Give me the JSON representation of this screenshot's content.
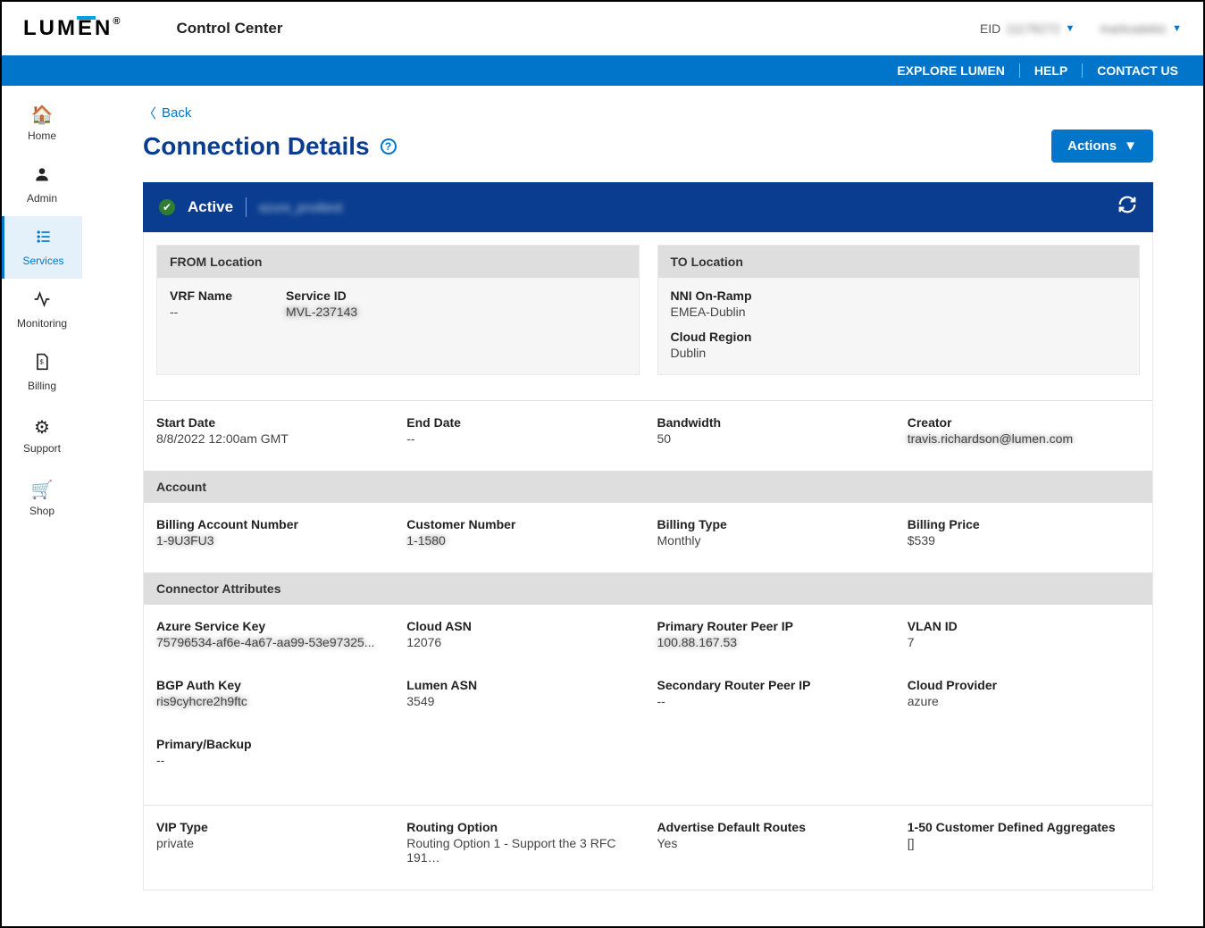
{
  "header": {
    "logo_text": "LUM",
    "logo_text2": "E",
    "logo_text3": "N",
    "app_title": "Control Center",
    "eid_label": "EID",
    "eid_value": "11176272",
    "username": "markoalekic"
  },
  "bluebar": {
    "explore": "EXPLORE LUMEN",
    "help": "HELP",
    "contact": "CONTACT US"
  },
  "sidebar": {
    "items": [
      {
        "label": "Home"
      },
      {
        "label": "Admin"
      },
      {
        "label": "Services"
      },
      {
        "label": "Monitoring"
      },
      {
        "label": "Billing"
      },
      {
        "label": "Support"
      },
      {
        "label": "Shop"
      }
    ]
  },
  "back_label": "Back",
  "page_title": "Connection Details",
  "actions_label": "Actions",
  "status": {
    "state": "Active",
    "name": "azure_prodtest"
  },
  "from": {
    "heading": "FROM Location",
    "vrf_label": "VRF Name",
    "vrf_value": "--",
    "service_id_label": "Service ID",
    "service_id_value": "MVL-237143"
  },
  "to": {
    "heading": "TO Location",
    "nni_label": "NNI On-Ramp",
    "nni_value": "EMEA-Dublin",
    "region_label": "Cloud Region",
    "region_value": "Dublin"
  },
  "dates": {
    "start_label": "Start Date",
    "start_value": "8/8/2022 12:00am GMT",
    "end_label": "End Date",
    "end_value": "--",
    "bandwidth_label": "Bandwidth",
    "bandwidth_value": "50",
    "creator_label": "Creator",
    "creator_value": "travis.richardson@lumen.com"
  },
  "account": {
    "heading": "Account",
    "ban_label": "Billing Account Number",
    "ban_value": "1-9U3FU3",
    "cust_label": "Customer Number",
    "cust_value": "1-1580",
    "btype_label": "Billing Type",
    "btype_value": "Monthly",
    "bprice_label": "Billing Price",
    "bprice_value": "$539"
  },
  "connector": {
    "heading": "Connector Attributes",
    "ask_label": "Azure Service Key",
    "ask_value": "75796534-af6e-4a67-aa99-53e97325...",
    "casn_label": "Cloud ASN",
    "casn_value": "12076",
    "prp_label": "Primary Router Peer IP",
    "prp_value": "100.88.167.53",
    "vlan_label": "VLAN ID",
    "vlan_value": "7",
    "bgp_label": "BGP Auth Key",
    "bgp_value": "ris9cyhcre2h9ftc",
    "lasn_label": "Lumen ASN",
    "lasn_value": "3549",
    "srp_label": "Secondary Router Peer IP",
    "srp_value": "--",
    "cp_label": "Cloud Provider",
    "cp_value": "azure",
    "pb_label": "Primary/Backup",
    "pb_value": "--"
  },
  "routing": {
    "vip_label": "VIP Type",
    "vip_value": "private",
    "ro_label": "Routing Option",
    "ro_value": "Routing Option 1 - Support the 3 RFC 191…",
    "adr_label": "Advertise Default Routes",
    "adr_value": "Yes",
    "agg_label": "1-50 Customer Defined Aggregates",
    "agg_value": "[]"
  }
}
